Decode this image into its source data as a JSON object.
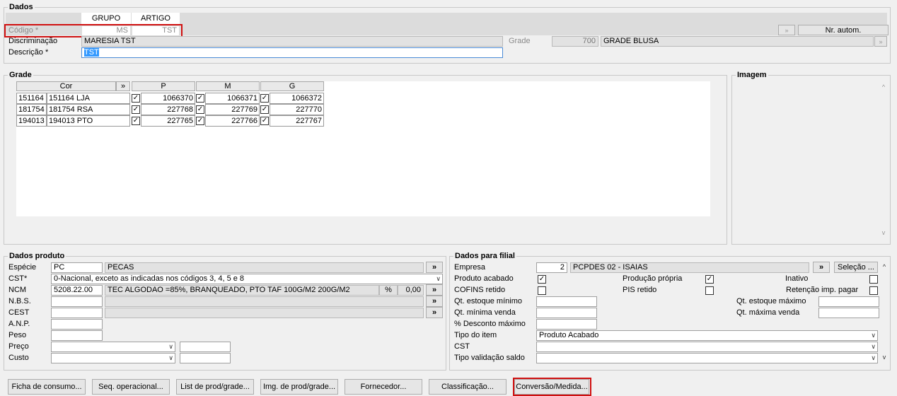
{
  "dados": {
    "legend": "Dados",
    "col_grupo": "GRUPO",
    "col_artigo": "ARTIGO",
    "codigo_label": "Código *",
    "codigo_grupo": "MS",
    "codigo_artigo": "TST",
    "discriminacao_label": "Discriminação",
    "discriminacao_value": "MARESIA TST",
    "descricao_label": "Descrição *",
    "descricao_value": "TST",
    "grade_label": "Grade",
    "grade_code": "700",
    "grade_name": "GRADE BLUSA",
    "nr_autom_label": "Nr. autom."
  },
  "grade": {
    "legend": "Grade",
    "headers": {
      "cor": "Cor",
      "expand": "»",
      "p": "P",
      "m": "M",
      "g": "G"
    },
    "rows": [
      {
        "code": "151164",
        "name": "151164 LJA",
        "p": "1066370",
        "m": "1066371",
        "g": "1066372"
      },
      {
        "code": "181754",
        "name": "181754 RSA",
        "p": "227768",
        "m": "227769",
        "g": "227770"
      },
      {
        "code": "194013",
        "name": "194013 PTO",
        "p": "227765",
        "m": "227766",
        "g": "227767"
      }
    ]
  },
  "imagem": {
    "legend": "Imagem"
  },
  "produto": {
    "legend": "Dados produto",
    "especie_label": "Espécie",
    "especie_code": "PC",
    "especie_name": "PECAS",
    "cst_label": "CST*",
    "cst_value": "0-Nacional, exceto as indicadas nos códigos 3, 4, 5 e 8",
    "ncm_label": "NCM",
    "ncm_code": "5208.22.00",
    "ncm_desc": "TEC ALGODAO  =85%, BRANQUEADO, PTO TAF 100G/M2 200G/M2",
    "ncm_pct_label": "%",
    "ncm_pct_value": "0,00",
    "nbs_label": "N.B.S.",
    "cest_label": "CEST",
    "anp_label": "A.N.P.",
    "peso_label": "Peso",
    "preco_label": "Preço",
    "custo_label": "Custo",
    "expand": "»"
  },
  "filial": {
    "legend": "Dados para filial",
    "empresa_label": "Empresa",
    "empresa_code": "2",
    "empresa_name": "PCPDES 02 - ISAIAS",
    "selecao_label": "Seleção ...",
    "expand": "»",
    "produto_acabado_label": "Produto acabado",
    "producao_propria_label": "Produção própria",
    "inativo_label": "Inativo",
    "cofins_label": "COFINS retido",
    "pis_label": "PIS retido",
    "retencao_label": "Retenção imp. pagar",
    "qt_est_min_label": "Qt. estoque mínimo",
    "qt_est_max_label": "Qt. estoque máximo",
    "qt_min_venda_label": "Qt. mínima venda",
    "qt_max_venda_label": "Qt. máxima venda",
    "desc_max_label": "% Desconto máximo",
    "tipo_item_label": "Tipo do item",
    "tipo_item_value": "Produto Acabado",
    "cst_label": "CST",
    "tipo_valid_label": "Tipo validação saldo"
  },
  "buttons": {
    "ficha": "Ficha de consumo...",
    "seq": "Seq. operacional...",
    "list": "List de prod/grade...",
    "img": "Img. de prod/grade...",
    "fornecedor": "Fornecedor...",
    "classificacao": "Classificação...",
    "conversao": "Conversão/Medida..."
  },
  "colors": {
    "highlight": "#d01010",
    "selection": "#3399ff"
  }
}
